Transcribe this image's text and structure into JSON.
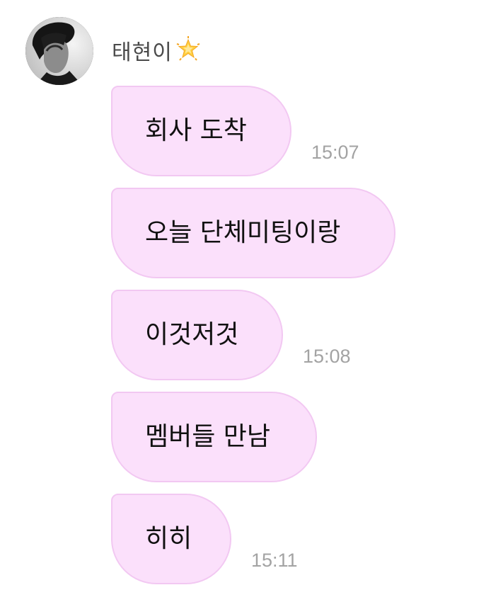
{
  "sender": {
    "name": "태현이",
    "badge_icon": "glowing-star-icon"
  },
  "messages": [
    {
      "text": "회사 도착",
      "time": "15:07"
    },
    {
      "text": "오늘 단체미팅이랑",
      "time": ""
    },
    {
      "text": "이것저것",
      "time": "15:08"
    },
    {
      "text": "멤버들 만남",
      "time": ""
    },
    {
      "text": "히히",
      "time": "15:11"
    }
  ],
  "colors": {
    "bubble_fill": "#fbe0fb",
    "bubble_border": "#f2c8f2",
    "timestamp": "#a3a3a3",
    "sender_name": "#4a4a4a"
  }
}
